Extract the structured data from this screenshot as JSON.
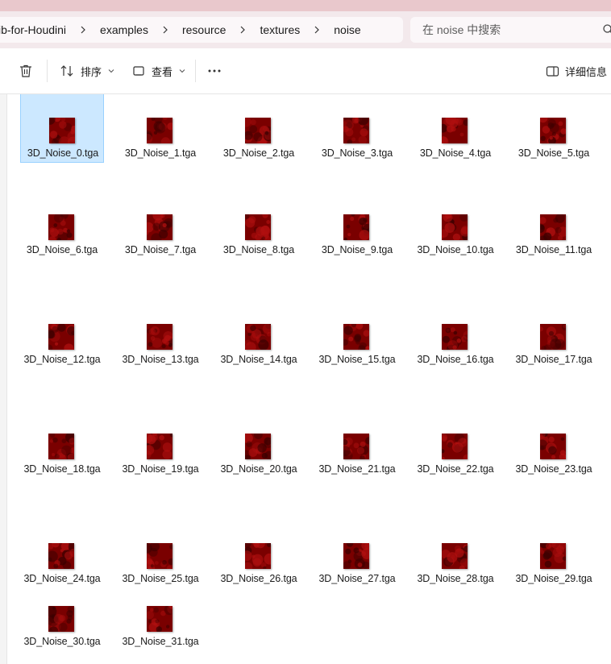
{
  "breadcrumb": [
    "ib-for-Houdini",
    "examples",
    "resource",
    "textures",
    "noise"
  ],
  "search": {
    "placeholder": "在 noise 中搜索"
  },
  "toolbar": {
    "sort_label": "排序",
    "view_label": "查看",
    "details_label": "详细信息"
  },
  "thumbnail_colors": {
    "base": "#7a0000",
    "dark": "#3a0000",
    "light": "#b01010"
  },
  "selection_colors": {
    "fill": "#cce8ff",
    "border": "#99d1ff"
  },
  "files": [
    "3D_Noise_0.tga",
    "3D_Noise_1.tga",
    "3D_Noise_2.tga",
    "3D_Noise_3.tga",
    "3D_Noise_4.tga",
    "3D_Noise_5.tga",
    "3D_Noise_6.tga",
    "3D_Noise_7.tga",
    "3D_Noise_8.tga",
    "3D_Noise_9.tga",
    "3D_Noise_10.tga",
    "3D_Noise_11.tga",
    "3D_Noise_12.tga",
    "3D_Noise_13.tga",
    "3D_Noise_14.tga",
    "3D_Noise_15.tga",
    "3D_Noise_16.tga",
    "3D_Noise_17.tga",
    "3D_Noise_18.tga",
    "3D_Noise_19.tga",
    "3D_Noise_20.tga",
    "3D_Noise_21.tga",
    "3D_Noise_22.tga",
    "3D_Noise_23.tga",
    "3D_Noise_24.tga",
    "3D_Noise_25.tga",
    "3D_Noise_26.tga",
    "3D_Noise_27.tga",
    "3D_Noise_28.tga",
    "3D_Noise_29.tga",
    "3D_Noise_30.tga",
    "3D_Noise_31.tga"
  ],
  "selected_file": "3D_Noise_0.tga"
}
